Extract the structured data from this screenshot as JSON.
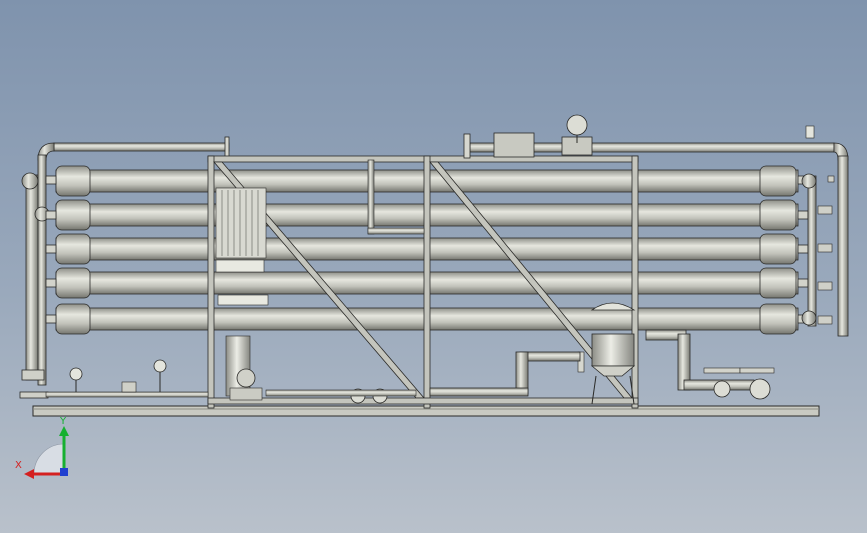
{
  "viewport": {
    "background_top": "#7f93ad",
    "background_bottom": "#b9c1cb"
  },
  "model": {
    "membrane_vessels": 5,
    "pipe_color": "#b8b9b0",
    "frame_color": "#c4c5bd",
    "outline_color": "#2a2a28"
  },
  "triad": {
    "x_label": "X",
    "y_label": "Y",
    "x_color": "#d42020",
    "y_color": "#16b030",
    "z_color": "#2040d0"
  }
}
